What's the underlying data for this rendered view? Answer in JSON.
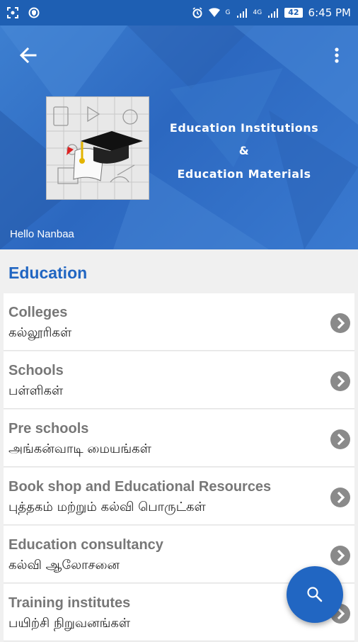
{
  "status_bar": {
    "time": "6:45 PM",
    "battery": "42",
    "network_1": "G",
    "network_2": "4G",
    "icons": [
      "screenshot-icon",
      "shield-icon",
      "alarm-icon",
      "wifi-icon",
      "signal-icon",
      "signal-icon",
      "battery-icon"
    ]
  },
  "header": {
    "title_line1": "Education Institutions",
    "title_line2": "&",
    "title_line3": "Education Materials",
    "greeting": "Hello Nanbaa",
    "colors": {
      "primary": "#2c68c0",
      "status": "#1e5fb3"
    }
  },
  "section": {
    "title": "Education"
  },
  "items": [
    {
      "en": "Colleges",
      "ta": "கல்லூரிகள்"
    },
    {
      "en": "Schools",
      "ta": "பள்ளிகள்"
    },
    {
      "en": "Pre schools",
      "ta": "அங்கன்வாடி மையங்கள்"
    },
    {
      "en": "Book shop and Educational Resources",
      "ta": "புத்தகம் மற்றும் கல்வி பொருட்கள்"
    },
    {
      "en": "Education consultancy",
      "ta": "கல்வி ஆலோசனை"
    },
    {
      "en": "Training institutes",
      "ta": "பயிற்சி நிறுவனங்கள்"
    }
  ],
  "fab": {
    "icon": "search-icon",
    "color": "#2166c2"
  }
}
